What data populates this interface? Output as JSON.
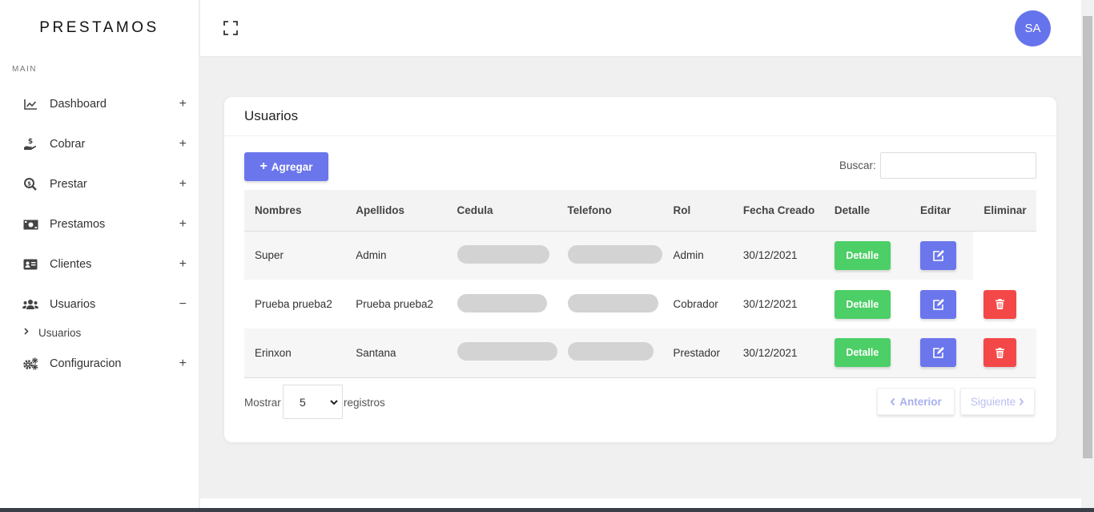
{
  "brand": "PRESTAMOS",
  "section_label": "MAIN",
  "nav": {
    "dashboard": "Dashboard",
    "cobrar": "Cobrar",
    "prestar": "Prestar",
    "prestamos": "Prestamos",
    "clientes": "Clientes",
    "usuarios": "Usuarios",
    "usuarios_sub": "Usuarios",
    "configuracion": "Configuracion",
    "plus": "+",
    "minus": "−"
  },
  "avatar": "SA",
  "card": {
    "title": "Usuarios",
    "add_button": "Agregar",
    "search_label": "Buscar:",
    "search_value": ""
  },
  "table": {
    "headers": {
      "nombres": "Nombres",
      "apellidos": "Apellidos",
      "cedula": "Cedula",
      "telefono": "Telefono",
      "rol": "Rol",
      "fecha": "Fecha Creado",
      "detalle": "Detalle",
      "editar": "Editar",
      "eliminar": "Eliminar"
    },
    "rows": [
      {
        "nombres": "Super",
        "apellidos": "Admin",
        "rol": "Admin",
        "fecha": "30/12/2021",
        "detalle": "Detalle"
      },
      {
        "nombres": "Prueba prueba2",
        "apellidos": "Prueba prueba2",
        "rol": "Cobrador",
        "fecha": "30/12/2021",
        "detalle": "Detalle"
      },
      {
        "nombres": "Erinxon",
        "apellidos": "Santana",
        "rol": "Prestador",
        "fecha": "30/12/2021",
        "detalle": "Detalle"
      }
    ]
  },
  "footer": {
    "show_label": "Mostrar",
    "page_size": "5",
    "registros_label": "registros",
    "prev": "Anterior",
    "next": "Siguiente"
  },
  "colors": {
    "primary": "#6b76ec",
    "success": "#4ccf66",
    "danger": "#f44848"
  }
}
